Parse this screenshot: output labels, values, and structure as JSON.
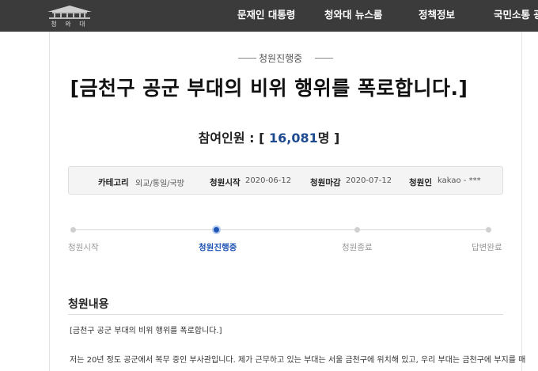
{
  "header": {
    "logo_icon": "blue-house-emblem-icon",
    "logo_text": "청 와 대",
    "nav": [
      "문재인 대통령",
      "청와대 뉴스룸",
      "정책정보",
      "국민소통 광"
    ]
  },
  "petition": {
    "status": "청원진행중",
    "title": "[금천구 공군 부대의 비위 행위를 폭로합니다.]",
    "count_label": "참여인원 : [",
    "count_value": "16,081",
    "count_unit": "명 ]",
    "info": {
      "category_label": "카테고리",
      "category_value": "외교/통일/국방",
      "start_label": "청원시작",
      "start_value": "2020-06-12",
      "end_label": "청원마감",
      "end_value": "2020-07-12",
      "author_label": "청원인",
      "author_value": "kakao - ***"
    },
    "progress": {
      "steps": [
        "청원시작",
        "청원진행중",
        "청원종료",
        "답변완료"
      ],
      "active_step": 1,
      "accent_color": "#1f56b6"
    },
    "content": {
      "heading": "청원내용",
      "lines": [
        "[금천구 공군 부대의 비위 행위를 폭로합니다.]",
        "저는 20년 정도 공군에서 복무 중인 부사관입니다. 제가 근무하고 있는 부대는 서울 금천구에 위치해 있고, 우리 부대는 금천구에 부지를 매"
      ]
    }
  }
}
